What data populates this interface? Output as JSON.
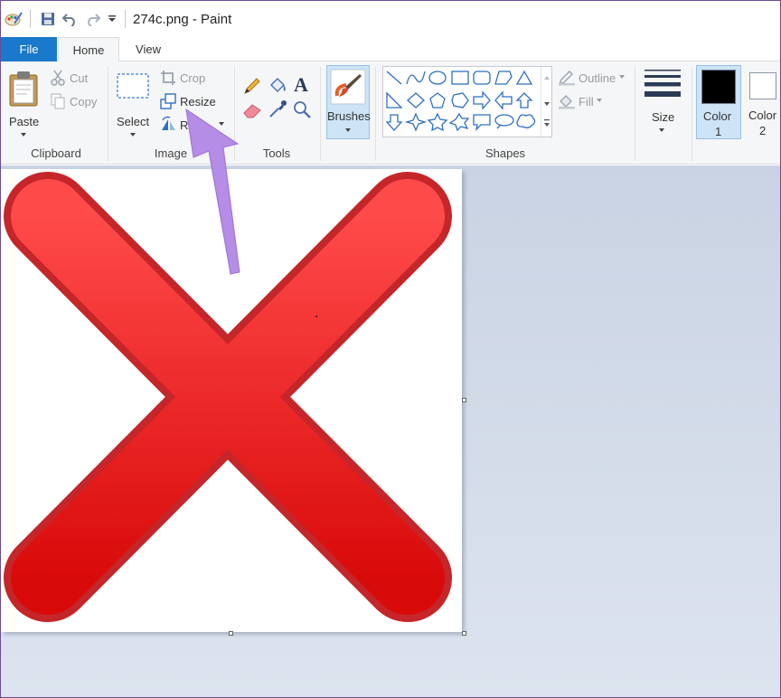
{
  "window": {
    "title": "274c.png - Paint"
  },
  "tabs": [
    {
      "label": "File"
    },
    {
      "label": "Home"
    },
    {
      "label": "View"
    }
  ],
  "clipboard": {
    "group": "Clipboard",
    "paste": "Paste",
    "cut": "Cut",
    "copy": "Copy"
  },
  "image": {
    "group": "Image",
    "select": "Select",
    "crop": "Crop",
    "resize": "Resize",
    "rotate": "Ro"
  },
  "tools": {
    "group": "Tools"
  },
  "brushes": {
    "label": "Brushes"
  },
  "shapes": {
    "group": "Shapes",
    "outline": "Outline",
    "fill": "Fill"
  },
  "size": {
    "label": "Size"
  },
  "colors": {
    "color1": "Color",
    "color1_num": "1",
    "color2": "Color",
    "color2_num": "2",
    "color1_value": "#000000",
    "color2_value": "#ffffff"
  },
  "theme": {
    "accent": "#1979ca",
    "arrow": "#b58ce6",
    "x_mark": "#e3201f"
  }
}
